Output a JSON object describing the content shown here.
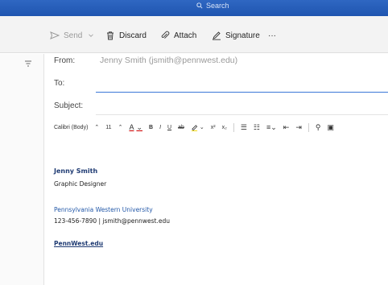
{
  "search": {
    "placeholder": "Search"
  },
  "toolbar": {
    "send_label": "Send",
    "discard_label": "Discard",
    "attach_label": "Attach",
    "signature_label": "Signature",
    "more_label": "···"
  },
  "compose": {
    "from_label": "From:",
    "from_value": "Jenny Smith (jsmith@pennwest.edu)",
    "to_label": "To:",
    "subject_label": "Subject:",
    "font_name": "Calibri (Body)",
    "font_size": "11"
  },
  "signature": {
    "name": "Jenny Smith",
    "title": "Graphic Designer",
    "university": "Pennsylvania Western University",
    "contact": "123-456-7890 | jsmith@pennwest.edu",
    "website": "PennWest.edu"
  }
}
